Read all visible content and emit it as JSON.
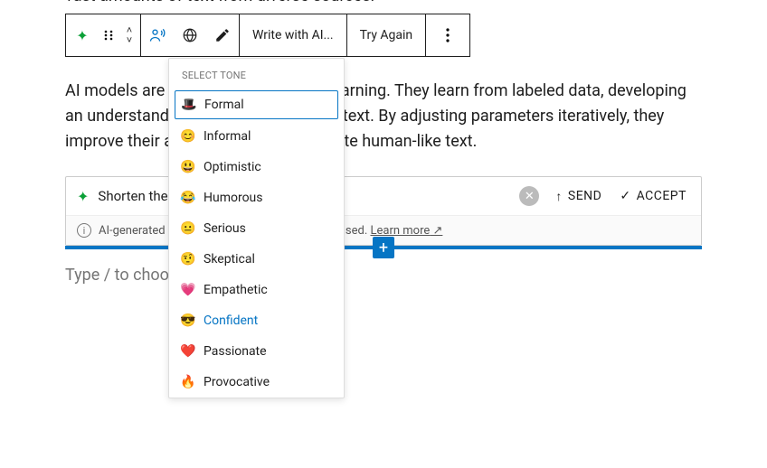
{
  "truncated_line": "vast amounts of text from diverse sources.",
  "toolbar": {
    "write_label": "Write with AI...",
    "tryagain_label": "Try Again"
  },
  "paragraph": "AI models are trained on supervised learning. They learn from labeled data, developing an understanding of language and context. By adjusting parameters iteratively, they improve their accuracy and can generate human-like text.",
  "ai_input": {
    "text": "Shorten the above texts.",
    "send_label": "SEND",
    "accept_label": "ACCEPT",
    "footer_text": "AI-generated content could be inaccurate or biased.",
    "learn_more": "Learn more"
  },
  "placeholder": "Type / to choose a block",
  "tone_menu": {
    "header": "SELECT TONE",
    "items": [
      {
        "emoji": "🎩",
        "label": "Formal",
        "state": "selected"
      },
      {
        "emoji": "😊",
        "label": "Informal",
        "state": ""
      },
      {
        "emoji": "😃",
        "label": "Optimistic",
        "state": ""
      },
      {
        "emoji": "😂",
        "label": "Humorous",
        "state": ""
      },
      {
        "emoji": "😐",
        "label": "Serious",
        "state": ""
      },
      {
        "emoji": "🤨",
        "label": "Skeptical",
        "state": ""
      },
      {
        "emoji": "💗",
        "label": "Empathetic",
        "state": ""
      },
      {
        "emoji": "😎",
        "label": "Confident",
        "state": "hover"
      },
      {
        "emoji": "❤️",
        "label": "Passionate",
        "state": ""
      },
      {
        "emoji": "🔥",
        "label": "Provocative",
        "state": ""
      }
    ]
  }
}
